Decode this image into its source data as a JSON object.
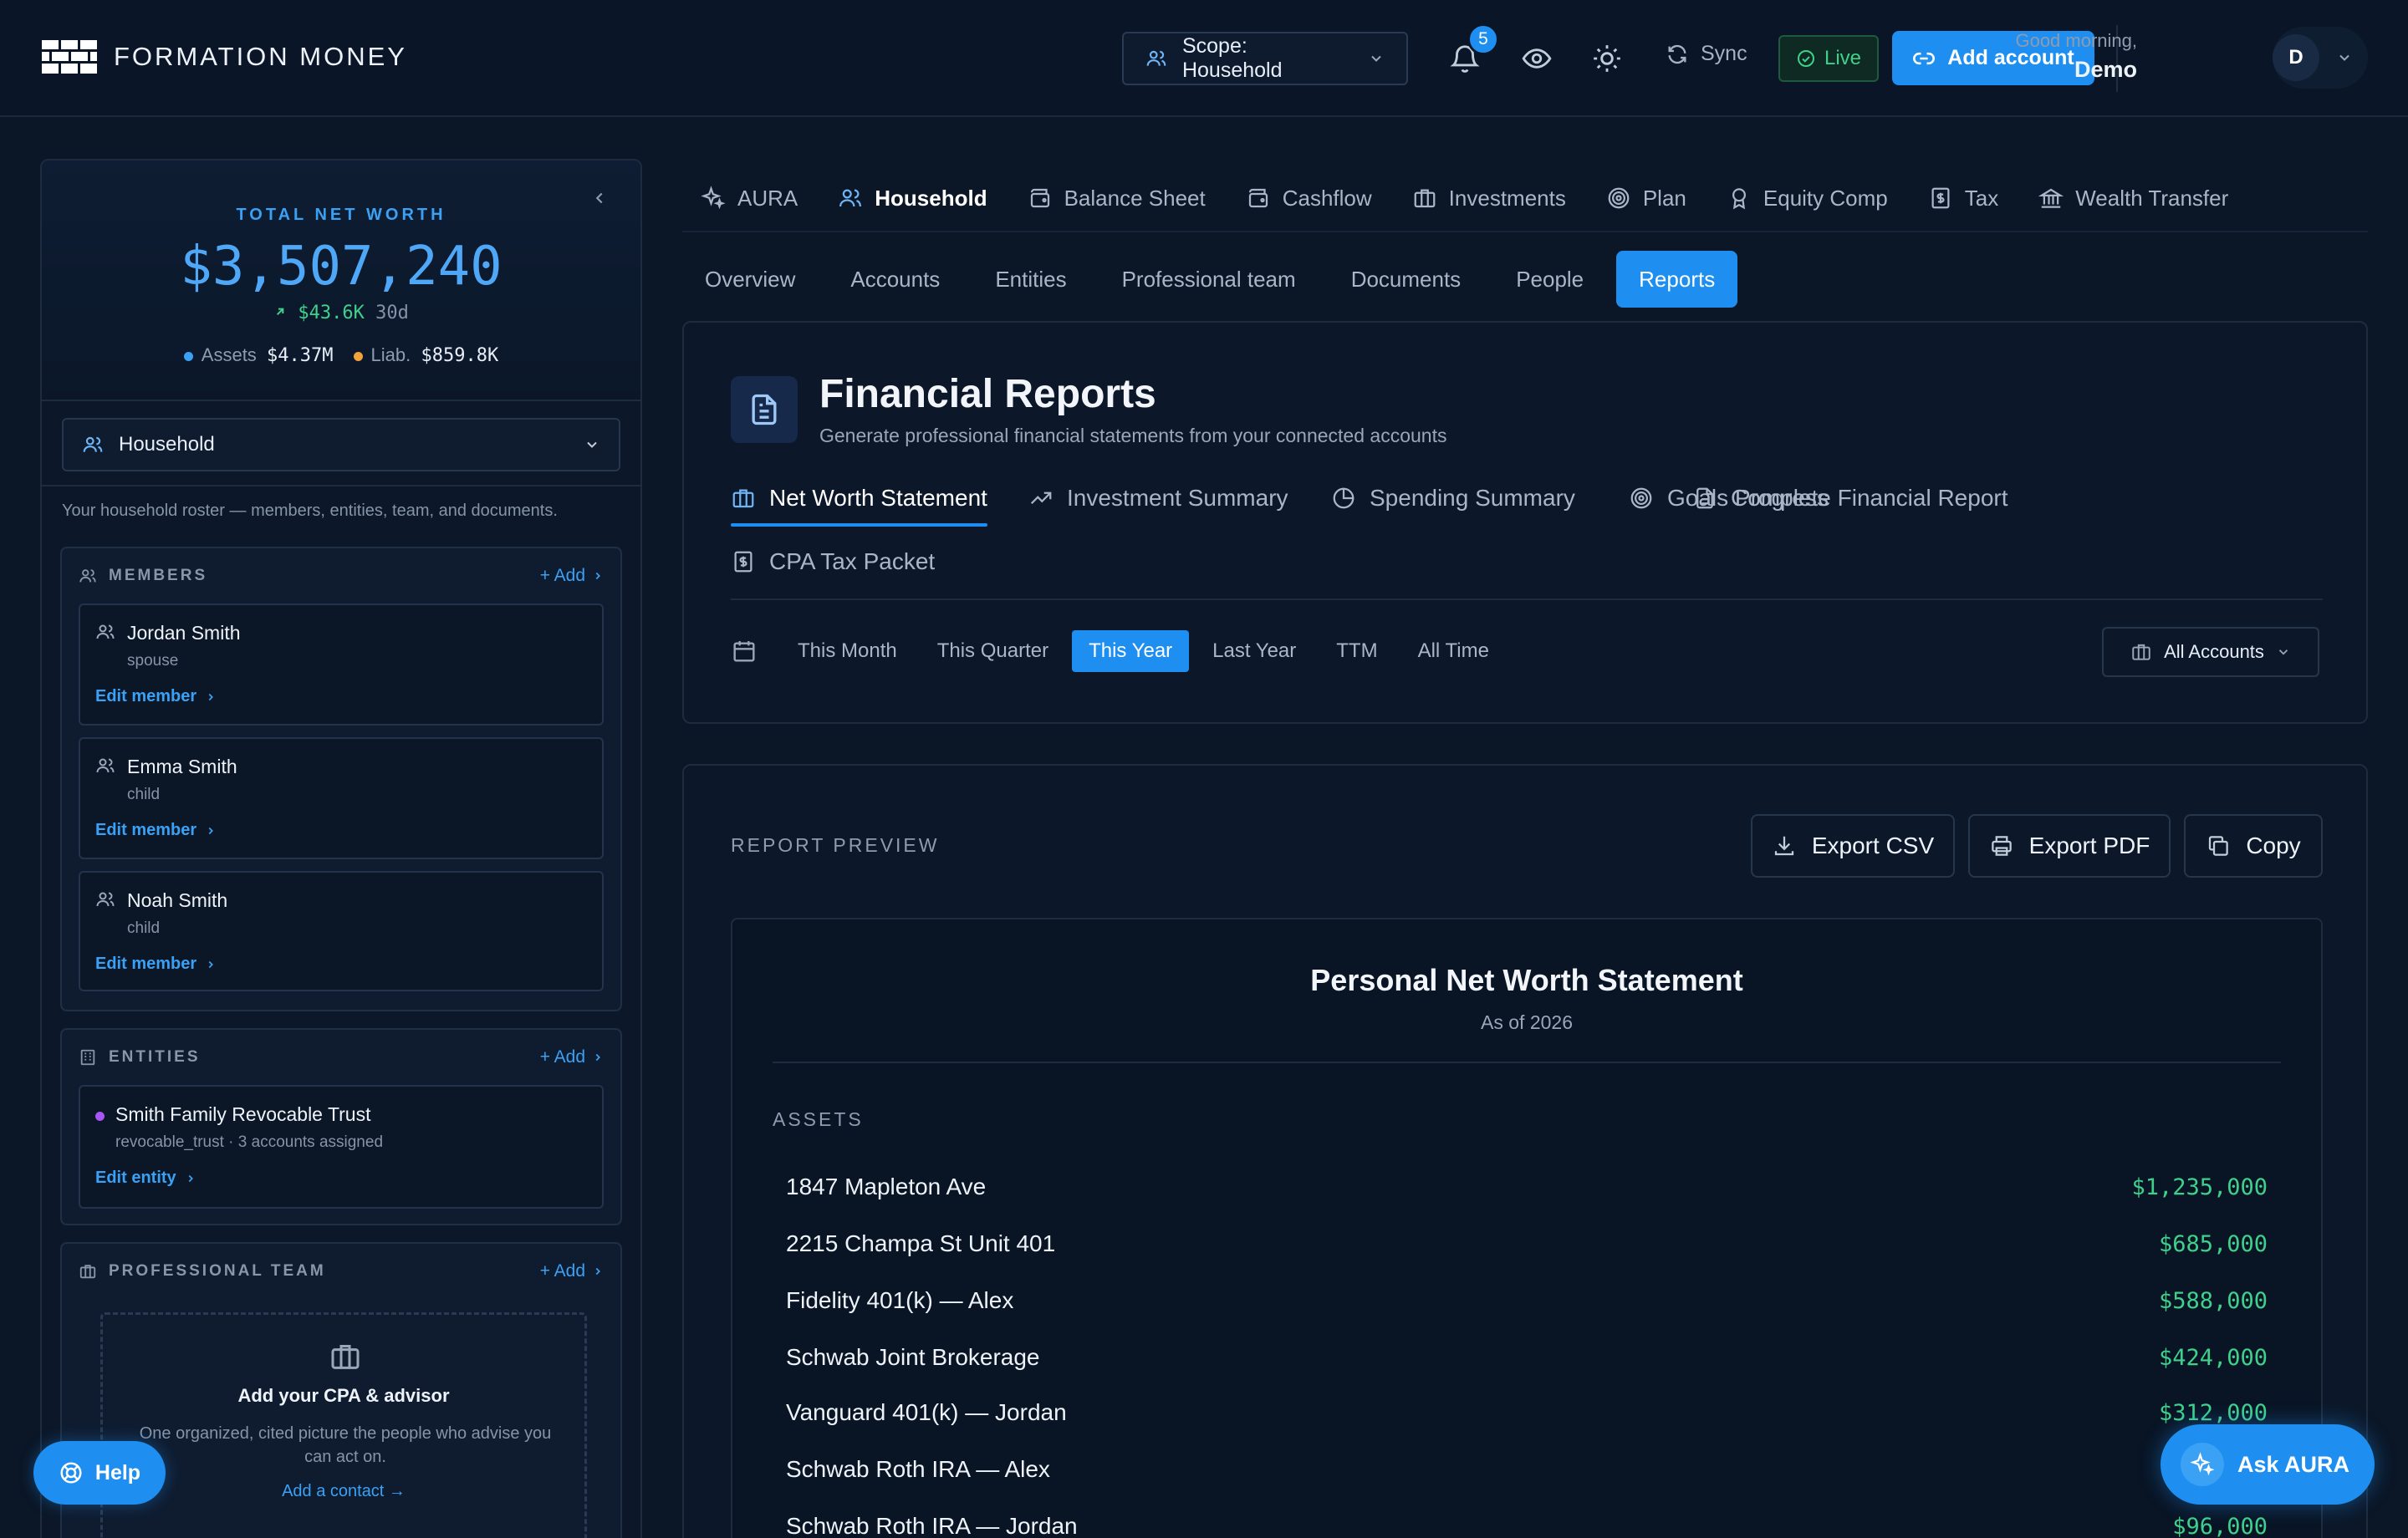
{
  "header": {
    "brand": "FORMATION MONEY",
    "scope_label": "Scope: Household",
    "notifications_count": "5",
    "sync_label": "Sync",
    "live_label": "Live",
    "add_account_label": "Add account",
    "greeting": "Good morning,",
    "user_name": "Demo",
    "avatar_initial": "D"
  },
  "sidebar": {
    "net_worth_label": "TOTAL NET WORTH",
    "net_worth_value": "$3,507,240",
    "change_value": "$43.6K",
    "change_period": "30d",
    "assets_label": "Assets",
    "assets_value": "$4.37M",
    "liab_label": "Liab.",
    "liab_value": "$859.8K",
    "household_select": "Household",
    "roster_text": "Your household roster — members, entities, team, and documents.",
    "members_title": "MEMBERS",
    "add_label": "+ Add",
    "members": [
      {
        "name": "Jordan Smith",
        "role": "spouse",
        "edit": "Edit member"
      },
      {
        "name": "Emma Smith",
        "role": "child",
        "edit": "Edit member"
      },
      {
        "name": "Noah Smith",
        "role": "child",
        "edit": "Edit member"
      }
    ],
    "entities_title": "ENTITIES",
    "entity": {
      "name": "Smith Family Revocable Trust",
      "meta": "revocable_trust · 3 accounts assigned",
      "edit": "Edit entity"
    },
    "team_title": "PROFESSIONAL TEAM",
    "team_empty_title": "Add your CPA & advisor",
    "team_empty_desc": "One organized, cited picture the people who advise you can act on.",
    "team_empty_link": "Add a contact →"
  },
  "main_nav": [
    "AURA",
    "Household",
    "Balance Sheet",
    "Cashflow",
    "Investments",
    "Plan",
    "Equity Comp",
    "Tax",
    "Wealth Transfer"
  ],
  "sub_nav": [
    "Overview",
    "Accounts",
    "Entities",
    "Professional team",
    "Documents",
    "People",
    "Reports"
  ],
  "reports": {
    "title": "Financial Reports",
    "subtitle": "Generate professional financial statements from your connected accounts",
    "tabs": [
      "Net Worth Statement",
      "Investment Summary",
      "Spending Summary",
      "Goals Progress",
      "Complete Financial Report",
      "CPA Tax Packet"
    ],
    "periods": [
      "This Month",
      "This Quarter",
      "This Year",
      "Last Year",
      "TTM",
      "All Time"
    ],
    "accounts_filter": "All Accounts"
  },
  "preview": {
    "label": "REPORT PREVIEW",
    "export_csv": "Export CSV",
    "export_pdf": "Export PDF",
    "copy": "Copy",
    "statement_title": "Personal Net Worth Statement",
    "statement_sub": "As of 2026",
    "section": "ASSETS",
    "rows": [
      {
        "name": "1847 Mapleton Ave",
        "value": "$1,235,000"
      },
      {
        "name": "2215 Champa St Unit 401",
        "value": "$685,000"
      },
      {
        "name": "Fidelity 401(k) — Alex",
        "value": "$588,000"
      },
      {
        "name": "Schwab Joint Brokerage",
        "value": "$424,000"
      },
      {
        "name": "Vanguard 401(k) — Jordan",
        "value": "$312,000"
      },
      {
        "name": "Schwab Roth IRA — Alex",
        "value": ""
      },
      {
        "name": "Schwab Roth IRA — Jordan",
        "value": "$96,000"
      }
    ]
  },
  "floating": {
    "help": "Help",
    "ask_aura": "Ask AURA"
  }
}
